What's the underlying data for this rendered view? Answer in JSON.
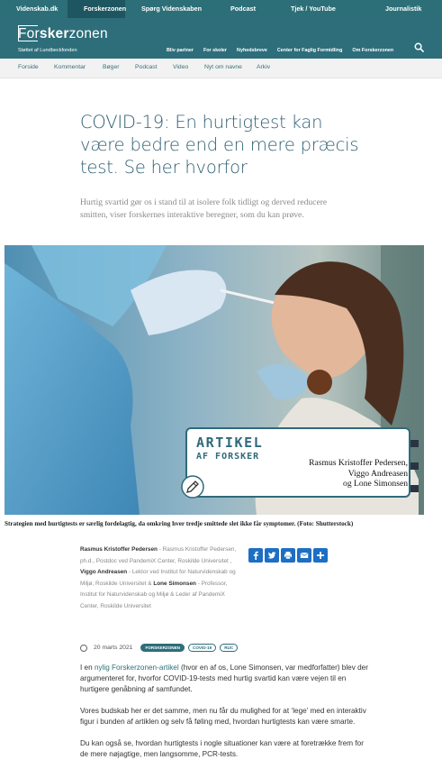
{
  "topnav": [
    "Videnskab.dk",
    "Forskerzonen",
    "Spørg Videnskaben",
    "Podcast",
    "Tjek / YouTube",
    "Journalistik"
  ],
  "header": {
    "logo_prefix": "Fo",
    "logo_rest_a": "r",
    "logo_bold": "sker",
    "logo_tail": "zonen",
    "logo_tagline": "Støttet af Lundbeckfonden",
    "nav": [
      "Bliv partner",
      "For skoler",
      "Nyhedsbreve",
      "Center for Faglig Formidling",
      "Om Forskerzonen"
    ]
  },
  "subnav": [
    "Forside",
    "Kommentar",
    "Bøger",
    "Podcast",
    "Video",
    "Nyt om navne",
    "Arkiv"
  ],
  "article": {
    "title": "COVID-19: En hurtigtest kan være bedre end en mere præcis test. Se her hvorfor",
    "lead": "Hurtig svartid gør os i stand til at isolere folk tidligt og derved reducere smitten, viser forskernes interaktive beregner, som du kan prøve.",
    "badge_line1": "ARTIKEL",
    "badge_line2": "AF FORSKER",
    "badge_author1": "Rasmus Kristoffer Pedersen,",
    "badge_author2": "Viggo Andreasen",
    "badge_author3": "og Lone Simonsen",
    "caption": "Strategien med hurtigtests er særlig fordelagtig, da omkring hver tredje smittede slet ikke får symptomer. (Foto: Shutterstock)",
    "authors": [
      {
        "name": "Rasmus Kristoffer Pedersen",
        "desc": " - Rasmus Kristoffer Pedersen, ph.d., Postdoc ved PandemiX Center, Roskilde Universitet , "
      },
      {
        "name": "Viggo Andreasen",
        "desc": " - Lektor ved Institut for Naturvidenskab og Miljø, Roskilde Universitet & "
      },
      {
        "name": "Lone Simonsen",
        "desc": " - Professor, Institut for Naturvidenskab og Miljø & Leder af PandemiX Center, Roskilde Universitet"
      }
    ],
    "date": "20 marts 2021",
    "tags": [
      "FORSKERZONEN",
      "COVID-19",
      "RUC"
    ],
    "p1_a": "I en ",
    "p1_link": "nylig Forskerzonen-artikel",
    "p1_b": " (hvor en af os, Lone Simonsen, var medforfatter) blev der argumenteret for, hvorfor COVID-19-tests med hurtig svartid kan være vejen til en hurtigere genåbning af samfundet.",
    "p2": "Vores budskab her er det samme, men nu får du mulighed for at ‘lege’ med en interaktiv figur i bunden af artiklen og selv få føling med, hvordan hurtigtests kan være smarte.",
    "p3": "Du kan også se, hvordan hurtigtests i nogle situationer kan være at foretrække frem for de mere nøjagtige, men langsomme, PCR-tests."
  },
  "colors": {
    "brand": "#2d6e7a",
    "title": "#2f5f74",
    "share": "#1c6fc4"
  }
}
